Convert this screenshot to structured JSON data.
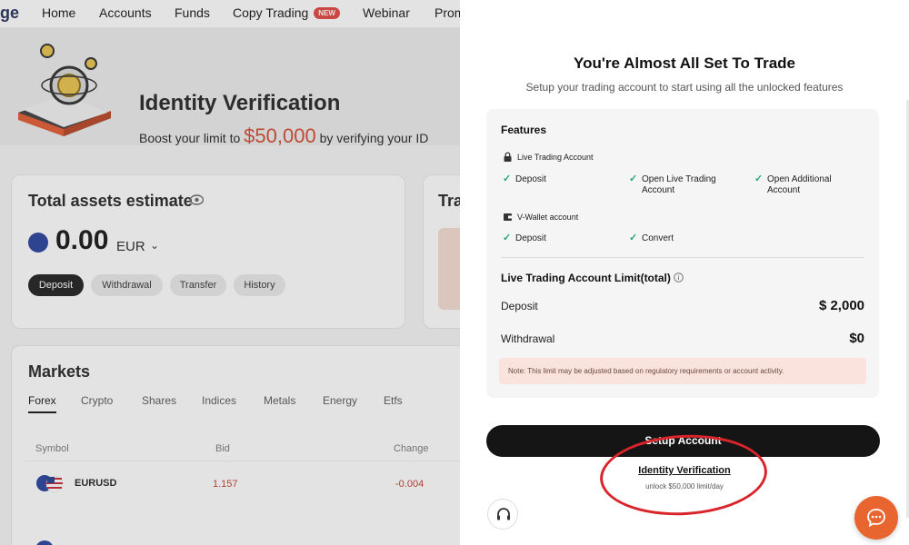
{
  "nav": {
    "logo": "ge",
    "items": [
      "Home",
      "Accounts",
      "Funds",
      "Copy Trading",
      "Webinar",
      "Prom"
    ],
    "new_badge": "NEW"
  },
  "hero": {
    "title": "Identity Verification",
    "sub_prefix": "Boost your limit to",
    "amount": "$50,000",
    "sub_suffix": "by verifying your ID"
  },
  "assets": {
    "title": "Total assets estimate",
    "balance": "0.00",
    "currency": "EUR",
    "buttons": [
      "Deposit",
      "Withdrawal",
      "Transfer",
      "History"
    ]
  },
  "side_card": {
    "title": "Tra"
  },
  "markets": {
    "title": "Markets",
    "tabs": [
      "Forex",
      "Crypto",
      "Shares",
      "Indices",
      "Metals",
      "Energy",
      "Etfs"
    ],
    "columns": [
      "Symbol",
      "Bid",
      "Change"
    ],
    "rows": [
      {
        "symbol": "EURUSD",
        "bid": "1.157",
        "change": "-0.004"
      }
    ]
  },
  "drawer": {
    "title": "You're Almost All Set To Trade",
    "subtitle": "Setup your trading account to start using all the unlocked features",
    "features_heading": "Features",
    "live_account_label": "Live Trading Account",
    "live_features": [
      "Deposit",
      "Open Live Trading Account",
      "Open Additional Account"
    ],
    "wallet_label": "V-Wallet account",
    "wallet_features": [
      "Deposit",
      "Convert"
    ],
    "limit_title": "Live Trading Account Limit(total)",
    "deposit_label": "Deposit",
    "deposit_value": "$ 2,000",
    "withdrawal_label": "Withdrawal",
    "withdrawal_value": "$0",
    "note": "Note: This limit may be adjusted based on regulatory requirements or account activity.",
    "setup_button": "Setup Account",
    "idv_link": "Identity Verification",
    "idv_sub": "unlock $50,000 limit/day"
  },
  "colors": {
    "accent": "#d2452b",
    "check": "#27a776",
    "chat_fab": "#e8652f",
    "annotation_circle": "#d8242a"
  },
  "icons": [
    "eye-icon",
    "chevron-down-icon",
    "lock-icon",
    "wallet-icon",
    "info-icon",
    "headset-icon",
    "chat-icon",
    "check-icon"
  ]
}
